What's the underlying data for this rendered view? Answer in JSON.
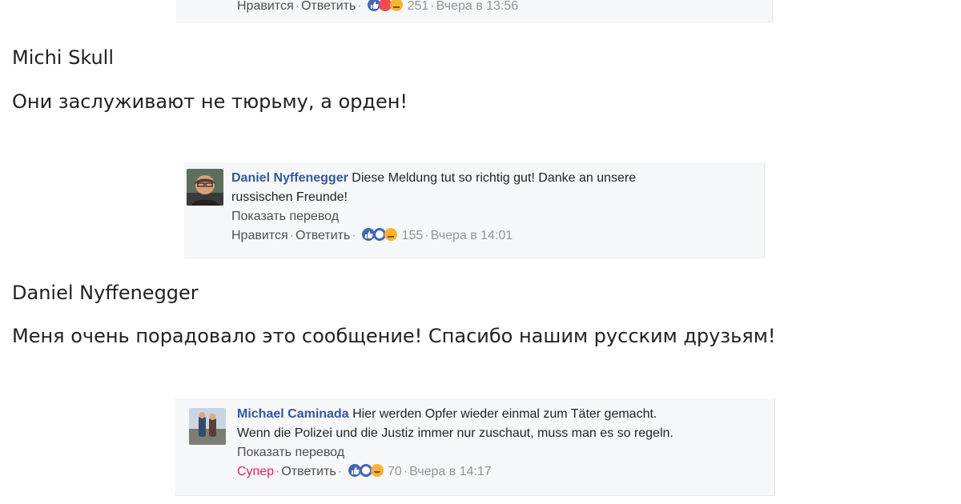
{
  "comments": [
    {
      "actions": {
        "like": "Нравится",
        "reply": "Ответить",
        "count": "251",
        "time": "Вчера в 13:56"
      }
    },
    {
      "author": "Daniel Nyffenegger",
      "text": "Diese Meldung tut so richtig gut! Danke an unsere",
      "text2": "russischen Freunde!",
      "translate": "Показать перевод",
      "actions": {
        "like": "Нравится",
        "reply": "Ответить",
        "count": "155",
        "time": "Вчера в 14:01"
      }
    },
    {
      "author": "Michael Caminada",
      "text": "Hier werden Opfer wieder einmal zum Täter gemacht.",
      "text2": "Wenn die Polizei und die Justiz immer nur zuschaut, muss man es so regeln.",
      "translate": "Показать перевод",
      "actions": {
        "like": "Супер",
        "reply": "Ответить",
        "count": "70",
        "time": "Вчера в 14:17"
      }
    }
  ],
  "translations": [
    {
      "name": "Michi Skull",
      "text": "Они заслуживают не тюрьму, а орден!"
    },
    {
      "name": "Daniel Nyffenegger",
      "text": "Меня очень порадовало это сообщение! Спасибо нашим русским друзьям!"
    }
  ],
  "separator": "·",
  "colors": {
    "link_blue": "#365899",
    "super_red": "#e0245e",
    "card_bg": "#f6f7f9"
  }
}
